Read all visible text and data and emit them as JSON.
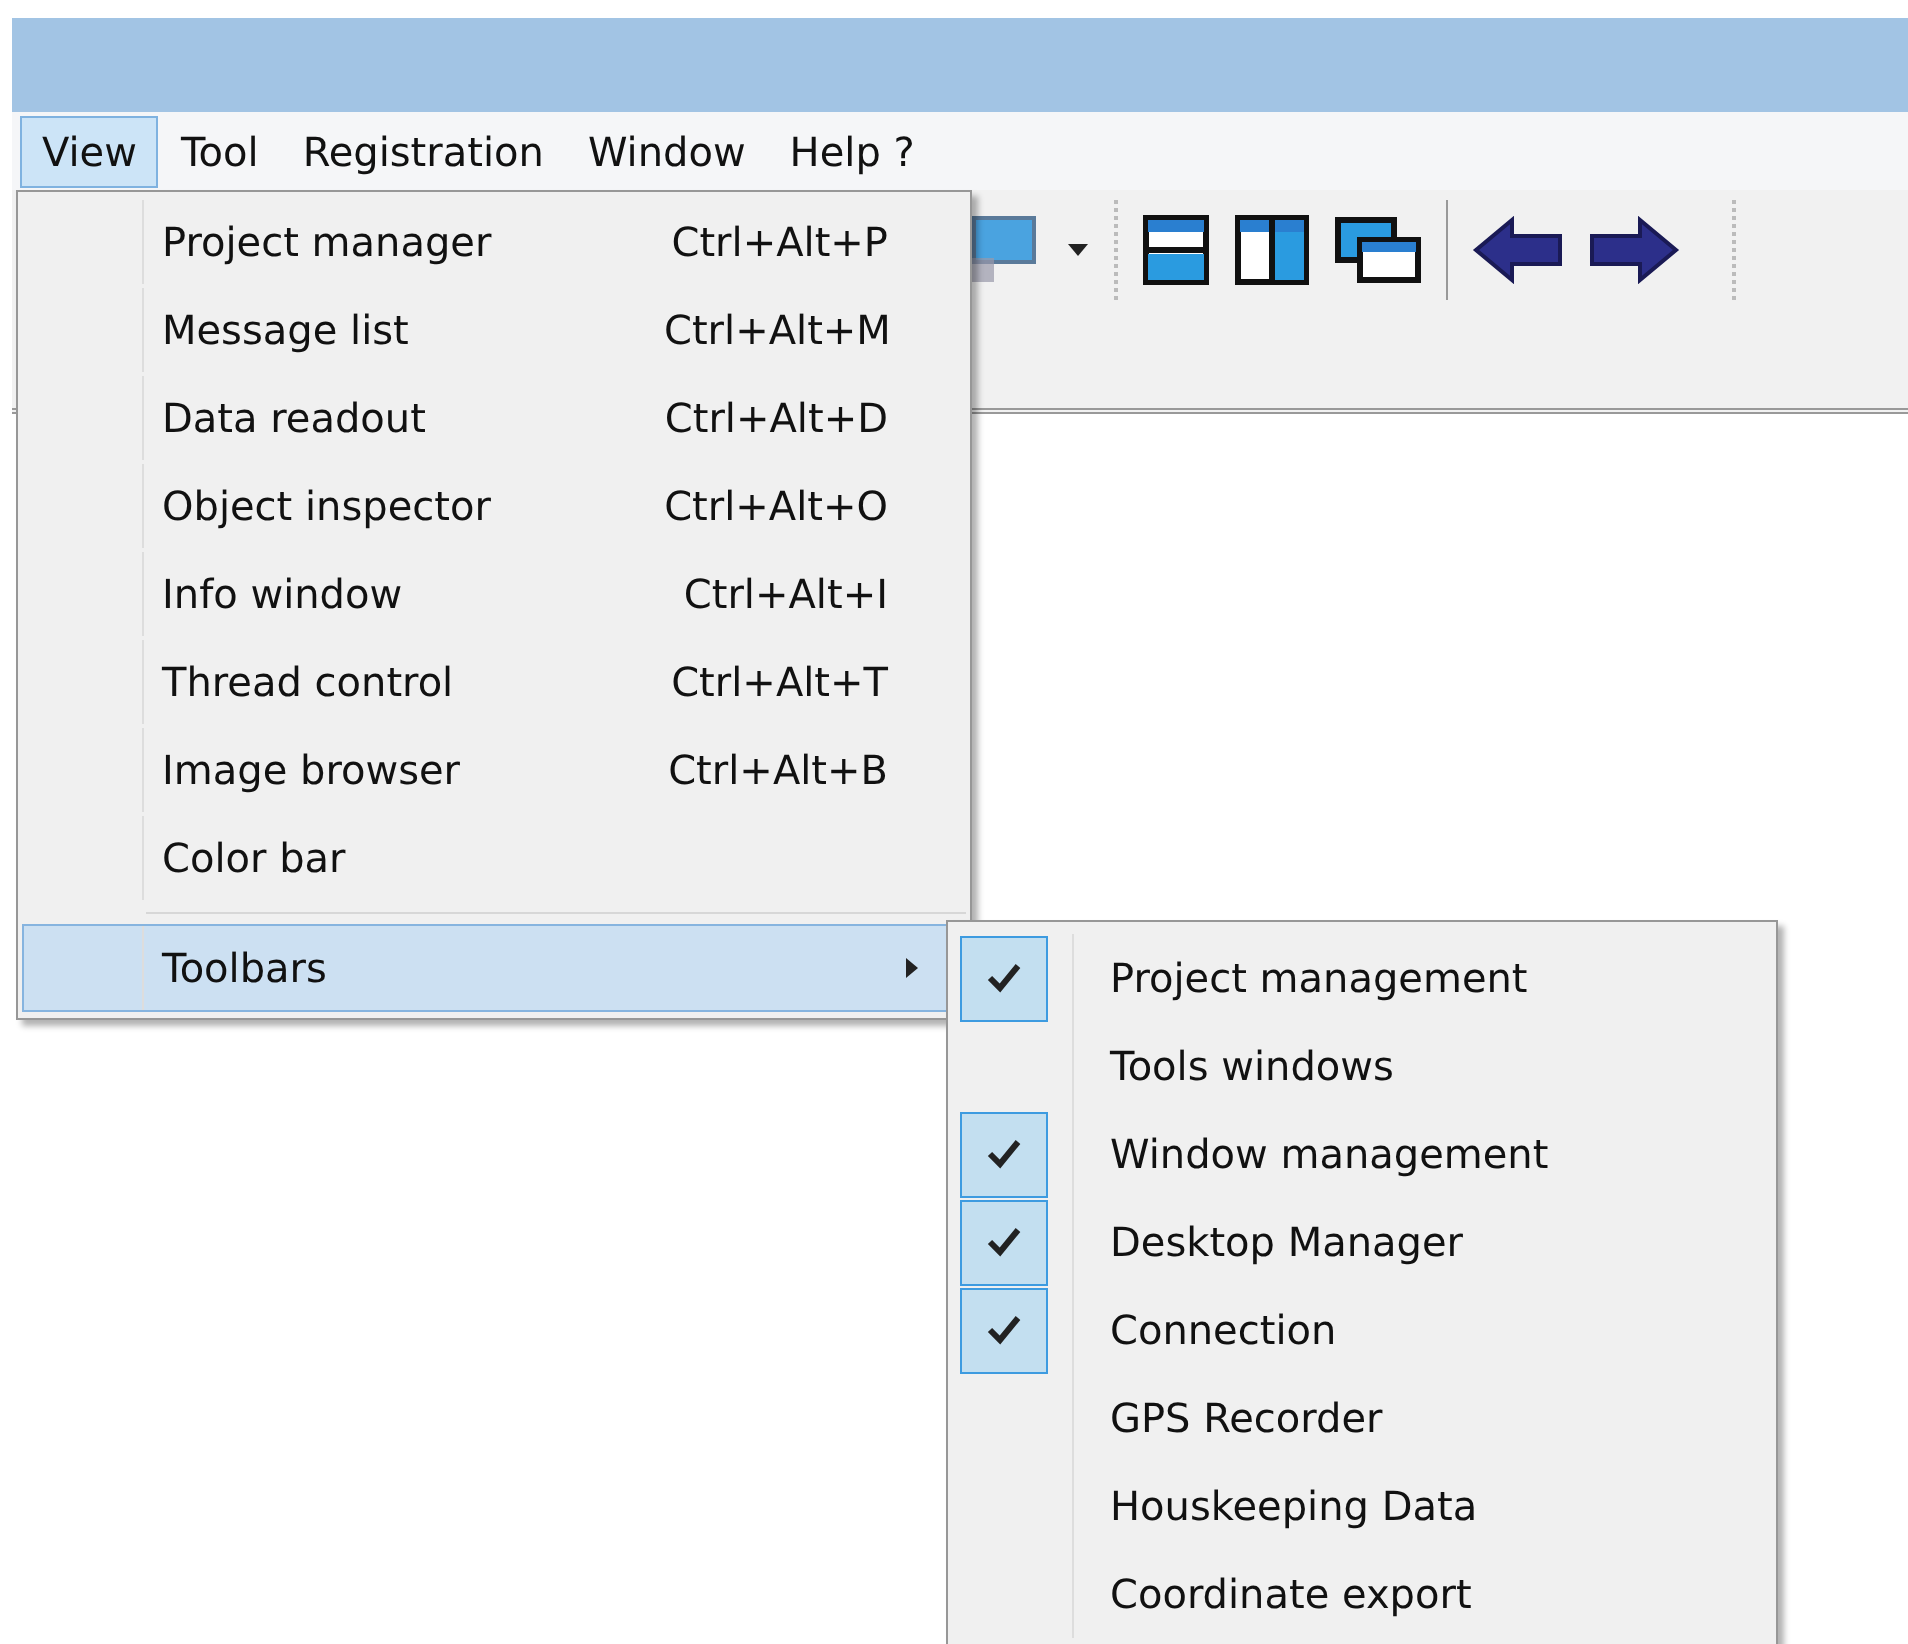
{
  "menubar": [
    {
      "label": "View",
      "selected": true
    },
    {
      "label": "Tool",
      "selected": false
    },
    {
      "label": "Registration",
      "selected": false
    },
    {
      "label": "Window",
      "selected": false
    },
    {
      "label": "Help ?",
      "selected": false
    }
  ],
  "view_menu": {
    "items": [
      {
        "label": "Project manager",
        "shortcut": "Ctrl+Alt+P"
      },
      {
        "label": "Message list",
        "shortcut": "Ctrl+Alt+M"
      },
      {
        "label": "Data readout",
        "shortcut": "Ctrl+Alt+D"
      },
      {
        "label": "Object inspector",
        "shortcut": "Ctrl+Alt+O"
      },
      {
        "label": "Info window",
        "shortcut": "Ctrl+Alt+I"
      },
      {
        "label": "Thread control",
        "shortcut": "Ctrl+Alt+T"
      },
      {
        "label": "Image browser",
        "shortcut": "Ctrl+Alt+B"
      },
      {
        "label": "Color bar"
      }
    ],
    "submenu": {
      "label": "Toolbars",
      "selected": true
    }
  },
  "toolbars_submenu": [
    {
      "label": "Project management",
      "checked": true
    },
    {
      "label": "Tools windows",
      "checked": false
    },
    {
      "label": "Window management",
      "checked": true
    },
    {
      "label": "Desktop Manager",
      "checked": true
    },
    {
      "label": "Connection",
      "checked": true
    },
    {
      "label": "GPS Recorder",
      "checked": false
    },
    {
      "label": "Houskeeping Data",
      "checked": false
    },
    {
      "label": "Coordinate export",
      "checked": false
    }
  ]
}
